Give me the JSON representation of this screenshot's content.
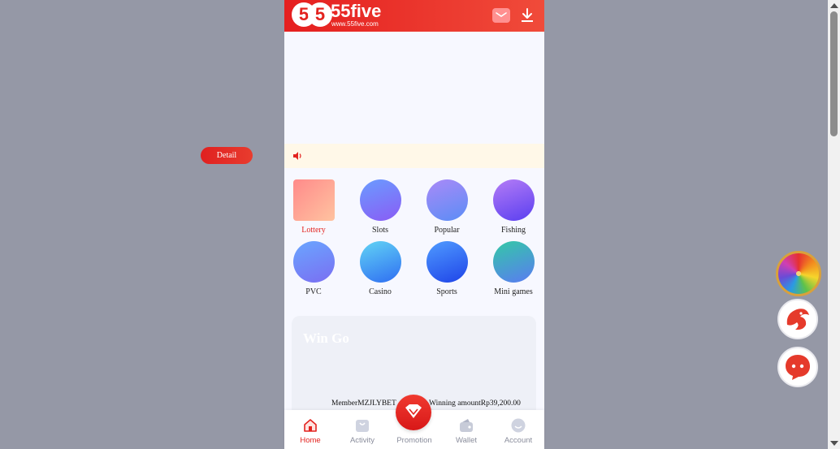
{
  "header": {
    "logo_digits": [
      "5",
      "5"
    ],
    "brand": "55five",
    "brand_url": "www.55five.com",
    "mail_icon": "mail-icon",
    "download_icon": "download-icon"
  },
  "notice": {
    "speaker_icon": "speaker-icon",
    "detail_label": "Detail"
  },
  "games": [
    {
      "label": "Lottery",
      "active": true
    },
    {
      "label": "Slots"
    },
    {
      "label": "Popular"
    },
    {
      "label": "Fishing"
    },
    {
      "label": "PVC"
    },
    {
      "label": "Casino"
    },
    {
      "label": "Sports"
    },
    {
      "label": "Mini games"
    }
  ],
  "wingo": {
    "title": "Win Go",
    "member": "MemberMZJLYBET",
    "winning": "Winning amountRp39,200.00"
  },
  "tabbar": {
    "home": "Home",
    "activity": "Activity",
    "promotion": "Promotion",
    "wallet": "Wallet",
    "account": "Account"
  },
  "floating": [
    "wheel-icon",
    "dragon-icon",
    "support-chat-icon"
  ],
  "colors": {
    "brand_red": "#e3231f",
    "page_bg": "#9598a6",
    "app_bg": "#f7f8ff",
    "notice_bg": "#fff8e8"
  }
}
